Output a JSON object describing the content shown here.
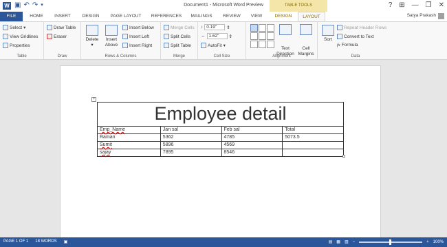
{
  "app": {
    "logo": "W",
    "title": "Document1 - Microsoft Word Preview",
    "contextual_group": "TABLE TOOLS",
    "user_name": "Satya Prakash"
  },
  "qat": {
    "save_icon": "save-icon",
    "undo_icon": "undo-icon",
    "redo_icon": "redo-icon"
  },
  "window": {
    "help": "?",
    "ribbon_opts": "⊞",
    "minimize": "—",
    "restore": "❐",
    "close": "✕"
  },
  "tabs": [
    {
      "label": "FILE"
    },
    {
      "label": "HOME"
    },
    {
      "label": "INSERT"
    },
    {
      "label": "DESIGN"
    },
    {
      "label": "PAGE LAYOUT"
    },
    {
      "label": "REFERENCES"
    },
    {
      "label": "MAILINGS"
    },
    {
      "label": "REVIEW"
    },
    {
      "label": "VIEW"
    },
    {
      "label": "DESIGN"
    },
    {
      "label": "LAYOUT"
    }
  ],
  "ribbon": {
    "table_group": {
      "label": "Table",
      "select": "Select",
      "view_gridlines": "View Gridlines",
      "properties": "Properties"
    },
    "draw_group": {
      "label": "Draw",
      "draw_table": "Draw Table",
      "eraser": "Eraser"
    },
    "rows_cols_group": {
      "label": "Rows & Columns",
      "delete": "Delete",
      "insert_above": "Insert Above",
      "insert_below": "Insert Below",
      "insert_left": "Insert Left",
      "insert_right": "Insert Right"
    },
    "merge_group": {
      "label": "Merge",
      "merge_cells": "Merge Cells",
      "split_cells": "Split Cells",
      "split_table": "Split Table"
    },
    "cell_size_group": {
      "label": "Cell Size",
      "height": "0.19\"",
      "width": "1.62\"",
      "autofit": "AutoFit"
    },
    "alignment_group": {
      "label": "Alignment",
      "text_direction": "Text Direction",
      "cell_margins": "Cell Margins"
    },
    "data_group": {
      "label": "Data",
      "sort": "Sort",
      "repeat_header_rows": "Repeat Header Rows",
      "convert_to_text": "Convert to Text",
      "formula": "Formula",
      "formula_icon": "fx"
    }
  },
  "document": {
    "table": {
      "title": "Employee detail",
      "headers": [
        "Emp_Name",
        "Jan sal",
        "Feb sal",
        "Total"
      ],
      "rows": [
        [
          "Raman",
          "5362",
          "4785",
          "5073.5"
        ],
        [
          "Sumit",
          "5896",
          "4569",
          ""
        ],
        [
          "sajay",
          "7895",
          "8546",
          ""
        ]
      ]
    }
  },
  "status": {
    "page": "PAGE 1 OF 1",
    "words": "18 WORDS",
    "zoom_minus": "−",
    "zoom_plus": "+",
    "zoom": "100%"
  }
}
